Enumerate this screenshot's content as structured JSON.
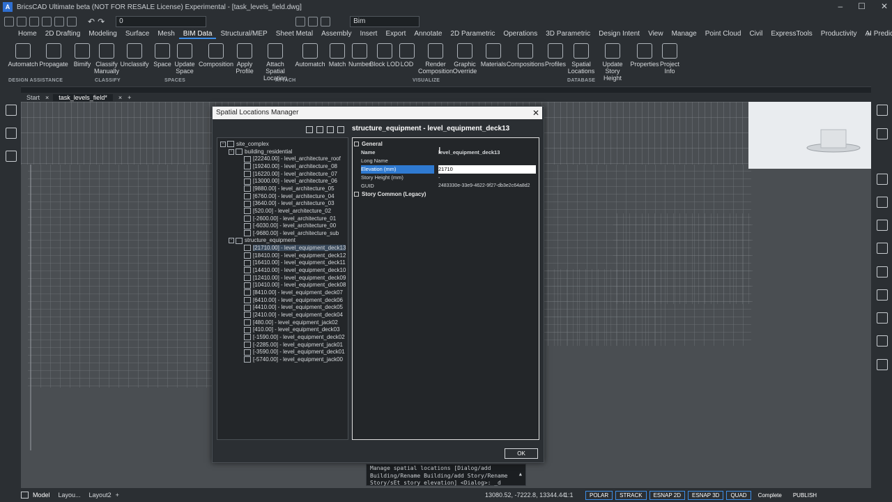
{
  "window": {
    "title": "BricsCAD Ultimate beta (NOT FOR RESALE License) Experimental - [task_levels_field.dwg]"
  },
  "quick_access": {
    "layer_value": "0",
    "workspace": "Bim"
  },
  "ribbon_tabs": [
    "Home",
    "2D Drafting",
    "Modeling",
    "Surface",
    "Mesh",
    "BIM Data",
    "Structural/MEP",
    "Sheet Metal",
    "Assembly",
    "Insert",
    "Export",
    "Annotate",
    "2D Parametric",
    "Operations",
    "3D Parametric",
    "Design Intent",
    "View",
    "Manage",
    "Point Cloud",
    "Civil",
    "ExpressTools",
    "Productivity",
    "AI Predict"
  ],
  "ribbon_active": "BIM Data",
  "ribbon_buttons": [
    {
      "label": "Automatch"
    },
    {
      "label": "Propagate"
    },
    {
      "label": "Bimify"
    },
    {
      "label": "Classify Manually"
    },
    {
      "label": "Unclassify"
    },
    {
      "label": "Space"
    },
    {
      "label": "Update Space"
    },
    {
      "label": "Composition"
    },
    {
      "label": "Apply Profile"
    },
    {
      "label": "Attach Spatial Location"
    },
    {
      "label": "Automatch"
    },
    {
      "label": "Match"
    },
    {
      "label": "Number"
    },
    {
      "label": "Block LOD"
    },
    {
      "label": "LOD"
    },
    {
      "label": "Render Composition"
    },
    {
      "label": "Graphic Override"
    },
    {
      "label": "Materials"
    },
    {
      "label": "Compositions"
    },
    {
      "label": "Profiles"
    },
    {
      "label": "Spatial Locations"
    },
    {
      "label": "Update Story Height"
    },
    {
      "label": "Properties"
    },
    {
      "label": "Project Info"
    }
  ],
  "ribbon_groups": [
    "DESIGN ASSISTANCE",
    "CLASSIFY",
    "SPACES",
    "ATTACH",
    "VISUALIZE",
    "DATABASE"
  ],
  "doc_tabs": [
    "Start",
    "task_levels_field*"
  ],
  "dialog": {
    "title": "Spatial Locations Manager",
    "ok": "OK",
    "tree": {
      "root": "site_complex",
      "buildings": [
        {
          "name": "building_residential",
          "stories": [
            "[22240.00] - level_architecture_roof",
            "[19240.00] - level_architecture_08",
            "[16220.00] - level_architecture_07",
            "[13000.00] - level_architecture_06",
            "[9880.00] - level_architecture_05",
            "[6760.00] - level_architecture_04",
            "[3640.00] - level_architecture_03",
            "[520.00] - level_architecture_02",
            "[-2600.00] - level_architecture_01",
            "[-6030.00] - level_architecture_00",
            "[-9680.00] - level_architecture_sub"
          ]
        },
        {
          "name": "structure_equipment",
          "stories": [
            "[21710.00] - level_equipment_deck13",
            "[18410.00] - level_equipment_deck12",
            "[16410.00] - level_equipment_deck11",
            "[14410.00] - level_equipment_deck10",
            "[12410.00] - level_equipment_deck09",
            "[10410.00] - level_equipment_deck08",
            "[8410.00] - level_equipment_deck07",
            "[6410.00] - level_equipment_deck06",
            "[4410.00] - level_equipment_deck05",
            "[2410.00] - level_equipment_deck04",
            "[480.00] - level_equipment_jack02",
            "[410.00] - level_equipment_deck03",
            "[-1590.00] - level_equipment_deck02",
            "[-2285.00] - level_equipment_jack01",
            "[-3590.00] - level_equipment_deck01",
            "[-5740.00] - level_equipment_jack00"
          ]
        }
      ]
    },
    "props": {
      "header": "structure_equipment - level_equipment_deck13",
      "section_general": "General",
      "rows": [
        {
          "k": "Name",
          "v": "level_equipment_deck13"
        },
        {
          "k": "Long Name",
          "v": ""
        },
        {
          "k": "Elevation (mm)",
          "v": "21710"
        },
        {
          "k": "Story Height (mm)",
          "v": "-"
        },
        {
          "k": "GUID",
          "v": "2483330e-33e9-4622-9f27-db3e2c64a8d2"
        }
      ],
      "section_legacy": "Story Common (Legacy)"
    }
  },
  "command_line": [
    "Manage spatial locations [Dialog/add",
    "Building/Rename Building/add Story/Rename",
    "Story/sEt story elevation] <Dialog>: _d"
  ],
  "status": {
    "tabs": [
      "Model",
      "Layou...",
      "Layout2"
    ],
    "coords": "13080.52, -7222.8, 13344.44",
    "scale": "1:1",
    "toggles": [
      "POLAR",
      "STRACK",
      "ESNAP 2D",
      "ESNAP 3D",
      "QUAD",
      "Complete",
      "PUBLISH"
    ]
  }
}
